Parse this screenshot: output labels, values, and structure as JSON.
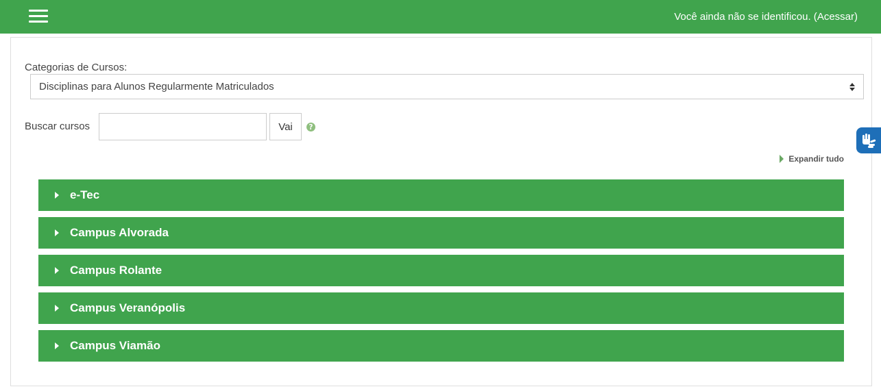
{
  "navbar": {
    "menu_icon": "hamburger-menu-icon",
    "login_prefix": "Você ainda não se identificou. (",
    "login_link": "Acessar",
    "login_suffix": ")",
    "color": "#40a44d"
  },
  "course_categories": {
    "label": "Categorias de Cursos:",
    "selected": "Disciplinas para Alunos Regularmente Matriculados"
  },
  "search": {
    "label": "Buscar cursos",
    "value": "",
    "button_label": "Vai",
    "help_icon": "question-circle-icon"
  },
  "expand_all": "Expandir tudo",
  "categories": [
    {
      "name": "e-Tec"
    },
    {
      "name": "Campus Alvorada"
    },
    {
      "name": "Campus Rolante"
    },
    {
      "name": "Campus Veranópolis"
    },
    {
      "name": "Campus Viamão"
    }
  ],
  "accessibility_widget": {
    "icon": "sign-language-hands-icon",
    "color": "#1e6fb8"
  }
}
